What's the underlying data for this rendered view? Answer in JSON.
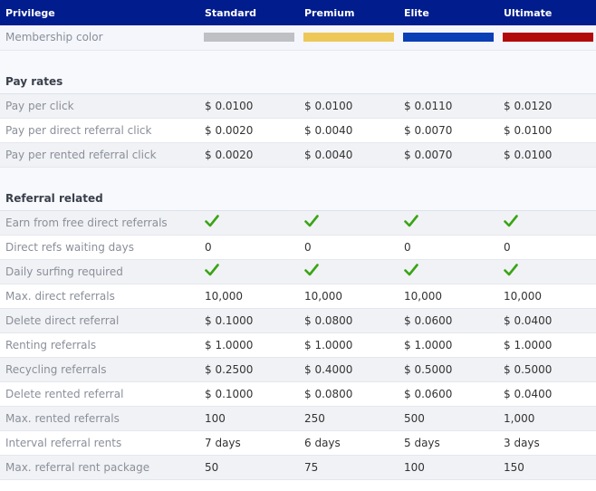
{
  "header": {
    "privilege": "Privilege",
    "tiers": [
      "Standard",
      "Premium",
      "Elite",
      "Ultimate"
    ]
  },
  "membership": {
    "label": "Membership color",
    "colors": [
      "#bfc0c4",
      "#edc858",
      "#0a3fb5",
      "#b20a0a"
    ]
  },
  "sections": {
    "pay_rates": "Pay rates",
    "referral_related": "Referral related"
  },
  "pay_rates": [
    {
      "label": "Pay per click",
      "values": [
        "$ 0.0100",
        "$ 0.0100",
        "$ 0.0110",
        "$ 0.0120"
      ]
    },
    {
      "label": "Pay per direct referral click",
      "values": [
        "$ 0.0020",
        "$ 0.0040",
        "$ 0.0070",
        "$ 0.0100"
      ]
    },
    {
      "label": "Pay per rented referral click",
      "values": [
        "$ 0.0020",
        "$ 0.0040",
        "$ 0.0070",
        "$ 0.0100"
      ]
    }
  ],
  "referral": [
    {
      "label": "Earn from free direct referrals",
      "check": true
    },
    {
      "label": "Direct refs waiting days",
      "values": [
        "0",
        "0",
        "0",
        "0"
      ]
    },
    {
      "label": "Daily surfing required",
      "check": true
    },
    {
      "label": "Max. direct referrals",
      "values": [
        "10,000",
        "10,000",
        "10,000",
        "10,000"
      ]
    },
    {
      "label": "Delete direct referral",
      "values": [
        "$ 0.1000",
        "$ 0.0800",
        "$ 0.0600",
        "$ 0.0400"
      ]
    },
    {
      "label": "Renting referrals",
      "values": [
        "$ 1.0000",
        "$ 1.0000",
        "$ 1.0000",
        "$ 1.0000"
      ]
    },
    {
      "label": "Recycling referrals",
      "values": [
        "$ 0.2500",
        "$ 0.4000",
        "$ 0.5000",
        "$ 0.5000"
      ]
    },
    {
      "label": "Delete rented referral",
      "values": [
        "$ 0.1000",
        "$ 0.0800",
        "$ 0.0600",
        "$ 0.0400"
      ]
    },
    {
      "label": "Max. rented referrals",
      "values": [
        "100",
        "250",
        "500",
        "1,000"
      ]
    },
    {
      "label": "Interval referral rents",
      "values": [
        "7 days",
        "6 days",
        "5 days",
        "3 days"
      ]
    },
    {
      "label": "Max. referral rent package",
      "values": [
        "50",
        "75",
        "100",
        "150"
      ]
    }
  ],
  "icons": {
    "check": "check-icon",
    "check_color": "#3aa415"
  }
}
